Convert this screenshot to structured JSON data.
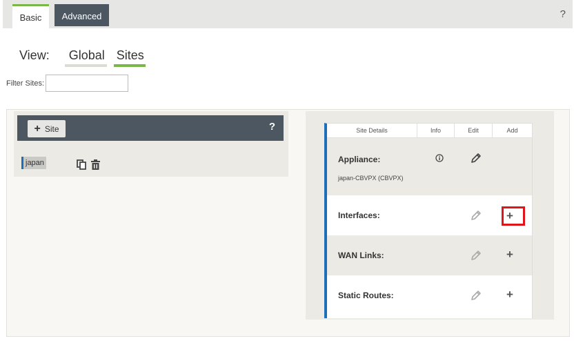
{
  "tabs": {
    "basic": "Basic",
    "advanced": "Advanced",
    "help": "?"
  },
  "view": {
    "label": "View:",
    "global": "Global",
    "sites": "Sites"
  },
  "filter": {
    "label": "Filter Sites:",
    "value": "",
    "placeholder": ""
  },
  "sites_panel": {
    "add_site": "Site",
    "help": "?",
    "items": [
      {
        "name": "japan"
      }
    ]
  },
  "details": {
    "headers": {
      "details": "Site Details",
      "info": "Info",
      "edit": "Edit",
      "add": "Add"
    },
    "appliance": {
      "label": "Appliance:",
      "value": "japan-CBVPX (CBVPX)"
    },
    "interfaces": {
      "label": "Interfaces:"
    },
    "wan_links": {
      "label": "WAN Links:"
    },
    "static_routes": {
      "label": "Static Routes:"
    }
  },
  "colors": {
    "accent_green": "#7ab648",
    "dark_header": "#4d5762",
    "site_blue": "#1f6fb8",
    "highlight_red": "#e0151b"
  },
  "icons": [
    "plus-icon",
    "help-icon",
    "copy-icon",
    "trash-icon",
    "info-icon",
    "pencil-icon"
  ]
}
